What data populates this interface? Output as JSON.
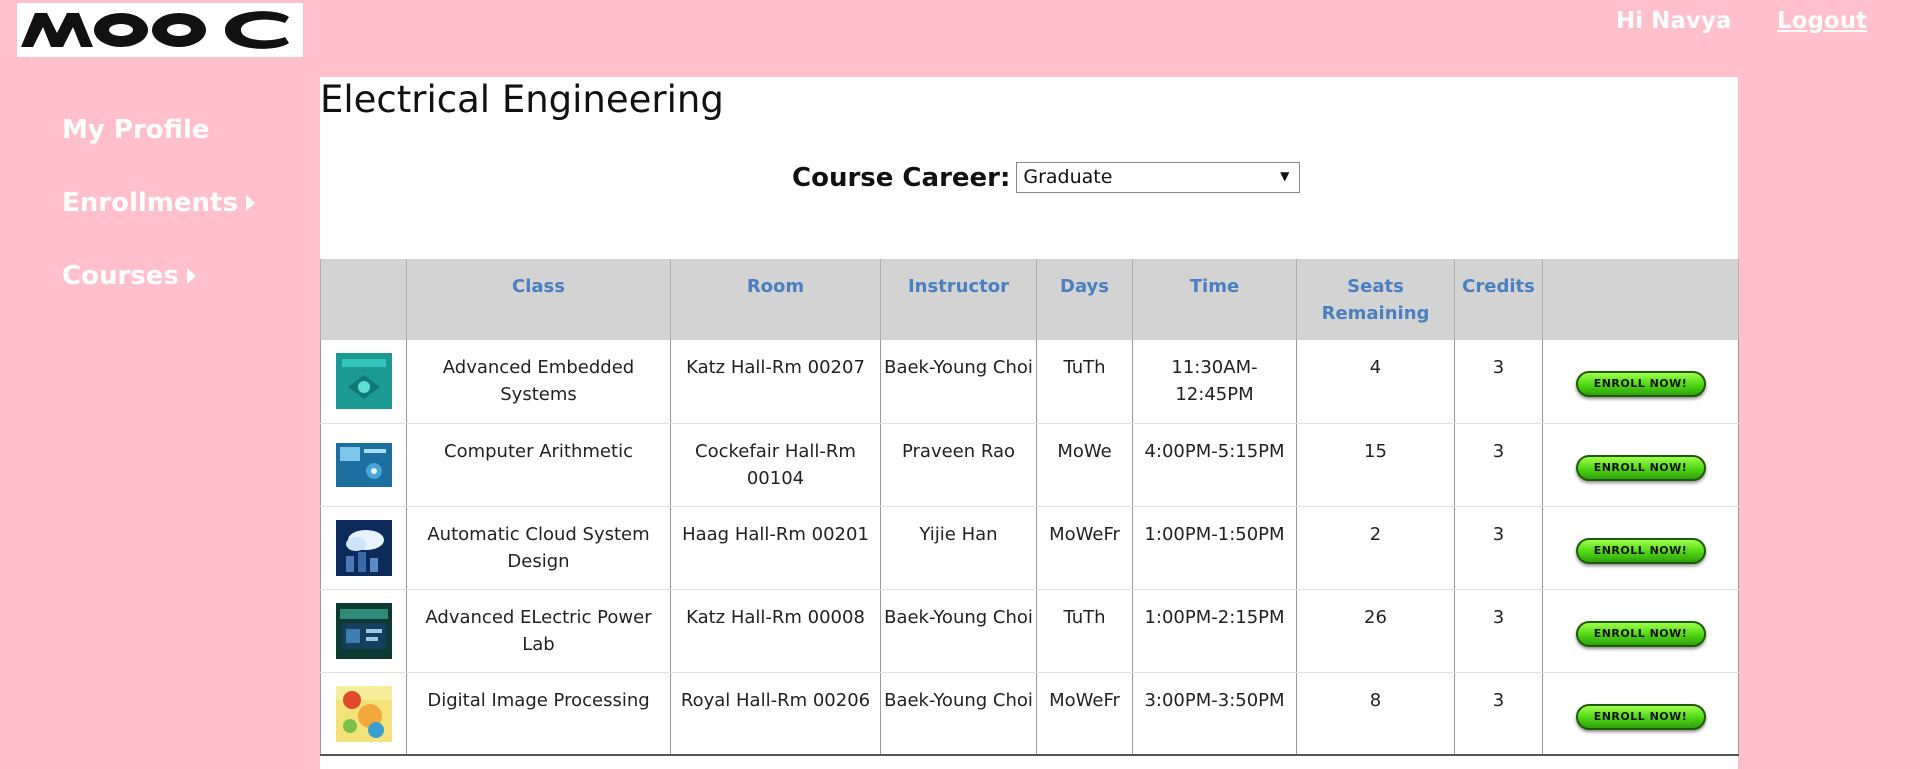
{
  "header": {
    "logo_text": "MOOC",
    "greeting": "Hi Navya",
    "logout_label": "Logout"
  },
  "sidebar": {
    "items": [
      {
        "label": "My Profile"
      },
      {
        "label": "Enrollments"
      },
      {
        "label": "Courses"
      }
    ]
  },
  "main": {
    "title": "Electrical Engineering",
    "career_label": "Course Career:",
    "career_value": "Graduate"
  },
  "table": {
    "headers": [
      "",
      "Class",
      "Room",
      "Instructor",
      "Days",
      "Time",
      "Seats Remaining",
      "Credits",
      ""
    ],
    "rows": [
      {
        "thumb": "book-cover-teal",
        "class": "Advanced Embedded Systems",
        "room": "Katz Hall-Rm 00207",
        "instructor": "Baek-Young Choi",
        "days": "TuTh",
        "time": "11:30AM-12:45PM",
        "seats": "4",
        "credits": "3",
        "action": "ENROLL NOW!"
      },
      {
        "thumb": "book-cover-blue",
        "class": "Computer Arithmetic",
        "room": "Cockefair Hall-Rm 00104",
        "instructor": "Praveen Rao",
        "days": "MoWe",
        "time": "4:00PM-5:15PM",
        "seats": "15",
        "credits": "3",
        "action": "ENROLL NOW!"
      },
      {
        "thumb": "book-cover-sky",
        "class": "Automatic Cloud System Design",
        "room": "Haag Hall-Rm 00201",
        "instructor": "Yijie Han",
        "days": "MoWeFr",
        "time": "1:00PM-1:50PM",
        "seats": "2",
        "credits": "3",
        "action": "ENROLL NOW!"
      },
      {
        "thumb": "book-cover-dark",
        "class": "Advanced ELectric Power Lab",
        "room": "Katz Hall-Rm 00008",
        "instructor": "Baek-Young Choi",
        "days": "TuTh",
        "time": "1:00PM-2:15PM",
        "seats": "26",
        "credits": "3",
        "action": "ENROLL NOW!"
      },
      {
        "thumb": "book-cover-yellow",
        "class": "Digital Image Processing",
        "room": "Royal Hall-Rm 00206",
        "instructor": "Baek-Young Choi",
        "days": "MoWeFr",
        "time": "3:00PM-3:50PM",
        "seats": "8",
        "credits": "3",
        "action": "ENROLL NOW!"
      }
    ]
  }
}
